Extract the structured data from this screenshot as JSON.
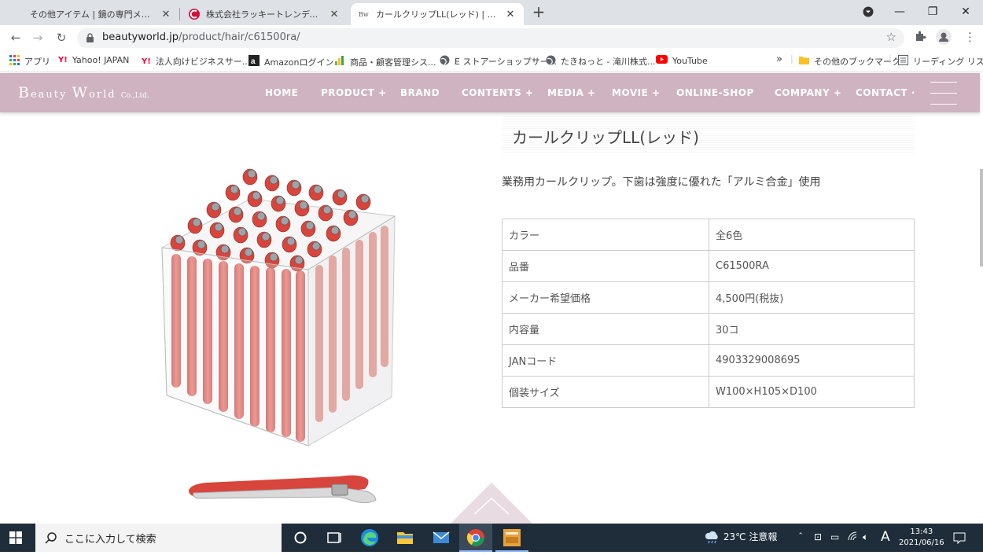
{
  "browser": {
    "tabs": [
      {
        "title": "その他アイテム | 鏡の専門メーカー 有",
        "active": false
      },
      {
        "title": "株式会社ラッキートレンディ コスメ雑",
        "active": false
      },
      {
        "title": "カールクリップLL(レッド) | 株式会社ビ",
        "active": true
      }
    ],
    "url_host": "beautyworld.jp",
    "url_path": "/product/hair/c61500ra/"
  },
  "bookmarks": [
    {
      "label": "アプリ",
      "icon": "apps-grid-icon"
    },
    {
      "label": "Yahoo! JAPAN",
      "icon": "yahoo-icon"
    },
    {
      "label": "法人向けビジネスサー...",
      "icon": "yahoo-icon"
    },
    {
      "label": "Amazonログイン",
      "icon": "amazon-icon"
    },
    {
      "label": "商品・顧客管理シス...",
      "icon": "chart-icon"
    },
    {
      "label": "E ストアーショップサー...",
      "icon": "globe-icon"
    },
    {
      "label": "たきねっと - 滝川株式...",
      "icon": "globe-icon"
    },
    {
      "label": "YouTube",
      "icon": "youtube-icon"
    }
  ],
  "bookmarks_more": "»",
  "bookmarks_other": "その他のブックマーク",
  "reading_list": "リーディング リスト",
  "site": {
    "logo_b": "B",
    "logo_eauty": "eauty",
    "logo_w": "W",
    "logo_orld": "orld",
    "logo_co": "Co.,Ltd.",
    "nav": [
      "HOME",
      "PRODUCT +",
      "BRAND",
      "CONTENTS +",
      "MEDIA +",
      "MOVIE +",
      "ONLINE-SHOP",
      "COMPANY +",
      "CONTACT ·"
    ],
    "accent": "#cfb3c0"
  },
  "product": {
    "title": "カールクリップLL(レッド)",
    "description": "業務用カールクリップ。下歯は強度に優れた「アルミ合金」使用",
    "specs": [
      {
        "label": "カラー",
        "value": "全6色"
      },
      {
        "label": "品番",
        "value": "C61500RA"
      },
      {
        "label": "メーカー希望価格",
        "value": "4,500円(税抜)"
      },
      {
        "label": "内容量",
        "value": "30コ"
      },
      {
        "label": "JANコード",
        "value": "4903329008695"
      },
      {
        "label": "個装サイズ",
        "value": "W100×H105×D100"
      }
    ]
  },
  "taskbar": {
    "search_placeholder": "ここに入力して検索",
    "weather": "23℃ 注意報",
    "ime": "A",
    "time": "13:43",
    "date": "2021/06/16"
  }
}
